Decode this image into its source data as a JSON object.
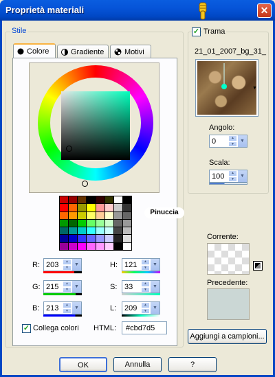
{
  "window": {
    "title": "Proprietà materiali",
    "close_glyph": "✕"
  },
  "style_group": {
    "label": "Stile"
  },
  "tabs": [
    {
      "label": "Colore",
      "icon": "solid-circle-icon"
    },
    {
      "label": "Gradiente",
      "icon": "gradient-icon"
    },
    {
      "label": "Motivi",
      "icon": "pattern-icon"
    }
  ],
  "watermark": "Pinuccia",
  "palette": [
    [
      "#cc0000",
      "#990000",
      "#663300",
      "#000000",
      "#330000",
      "#333300",
      "#ffffff",
      "#000000"
    ],
    [
      "#ff0000",
      "#ff6600",
      "#999900",
      "#ffff00",
      "#ff9999",
      "#ffcccc",
      "#cccccc",
      "#333333"
    ],
    [
      "#ff6600",
      "#ff9900",
      "#cccc00",
      "#ffff66",
      "#ffcc99",
      "#ffffcc",
      "#999999",
      "#666666"
    ],
    [
      "#009900",
      "#006600",
      "#00cc00",
      "#66ff66",
      "#99ff99",
      "#ccffcc",
      "#666666",
      "#999999"
    ],
    [
      "#006666",
      "#009999",
      "#00cccc",
      "#33ffff",
      "#99ffff",
      "#ccffff",
      "#444444",
      "#bbbbbb"
    ],
    [
      "#000099",
      "#0000cc",
      "#3333ff",
      "#6666ff",
      "#9999ff",
      "#ccccff",
      "#222222",
      "#dddddd"
    ],
    [
      "#990099",
      "#cc00cc",
      "#ff00ff",
      "#ff66ff",
      "#ff99ff",
      "#ffccff",
      "#000000",
      "#ffffff"
    ]
  ],
  "rgb": {
    "r_label": "R:",
    "r": "203",
    "g_label": "G:",
    "g": "215",
    "b_label": "B:",
    "b": "213"
  },
  "hsl": {
    "h_label": "H:",
    "h": "121",
    "s_label": "S:",
    "s": "33",
    "l_label": "L:",
    "l": "209"
  },
  "link_colors": {
    "label": "Collega colori",
    "checked": true
  },
  "html": {
    "label": "HTML:",
    "value": "#cbd7d5"
  },
  "texture": {
    "label": "Trama",
    "checked": true,
    "name": "21_01_2007_bg_31_"
  },
  "angle": {
    "label": "Angolo:",
    "value": "0"
  },
  "scale": {
    "label": "Scala:",
    "value": "100"
  },
  "current": {
    "label": "Corrente:"
  },
  "previous": {
    "label": "Precedente:",
    "color": "#cbd7d5"
  },
  "add_swatch": {
    "label": "Aggiungi a campioni..."
  },
  "buttons": {
    "ok": "OK",
    "cancel": "Annulla",
    "help": "?"
  }
}
